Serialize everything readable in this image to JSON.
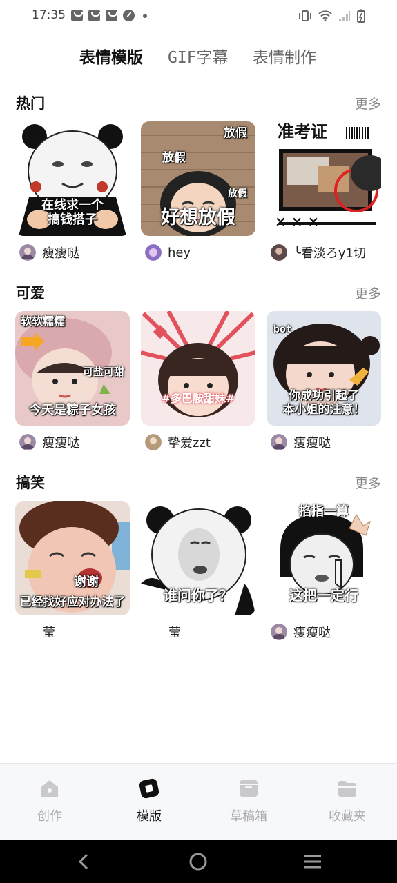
{
  "status": {
    "time": "17:35"
  },
  "tabs": [
    {
      "label": "表情模版",
      "active": true
    },
    {
      "label": "GIF字幕",
      "active": false
    },
    {
      "label": "表情制作",
      "active": false
    }
  ],
  "sections": [
    {
      "title": "热门",
      "more": "更多",
      "cards": [
        {
          "caption": "在线求一个\n搞钱搭子",
          "author": "瘦瘦哒",
          "has_avatar": true
        },
        {
          "caption_top": "放假",
          "caption_top2": "放假",
          "caption_mid": "放假",
          "caption": "好想放假",
          "author": "hey",
          "has_avatar": true
        },
        {
          "caption_top": "准考证",
          "caption": "× × ×",
          "author": "╰看淡ろy1切",
          "has_avatar": true
        }
      ]
    },
    {
      "title": "可爱",
      "more": "更多",
      "cards": [
        {
          "caption_top": "软软糯糯",
          "caption_mid": "可盐可甜",
          "caption": "今天是粽子女孩",
          "author": "瘦瘦哒",
          "has_avatar": true
        },
        {
          "caption": "#多巴胺甜妹#",
          "author": "挚爱zzt",
          "has_avatar": true
        },
        {
          "caption_top": "bot",
          "caption": "你成功引起了\n本小姐的注意！",
          "author": "瘦瘦哒",
          "has_avatar": true
        }
      ]
    },
    {
      "title": "搞笑",
      "more": "更多",
      "cards": [
        {
          "caption_mid": "谢谢",
          "caption": "已经找好应对办法了",
          "author": "莹",
          "has_avatar": false
        },
        {
          "caption": "谁问你了？",
          "author": "莹",
          "has_avatar": false
        },
        {
          "caption_top": "掐指一算",
          "caption": "这把一定行",
          "author": "瘦瘦哒",
          "has_avatar": true
        }
      ]
    }
  ],
  "bottom_nav": [
    {
      "label": "创作",
      "icon": "house-icon",
      "active": false
    },
    {
      "label": "模版",
      "icon": "template-icon",
      "active": true
    },
    {
      "label": "草稿箱",
      "icon": "drafts-box-icon",
      "active": false
    },
    {
      "label": "收藏夹",
      "icon": "folder-icon",
      "active": false
    }
  ],
  "colors": {
    "accent": "#111111",
    "inactive": "#aaaaaa",
    "more": "#888888"
  }
}
